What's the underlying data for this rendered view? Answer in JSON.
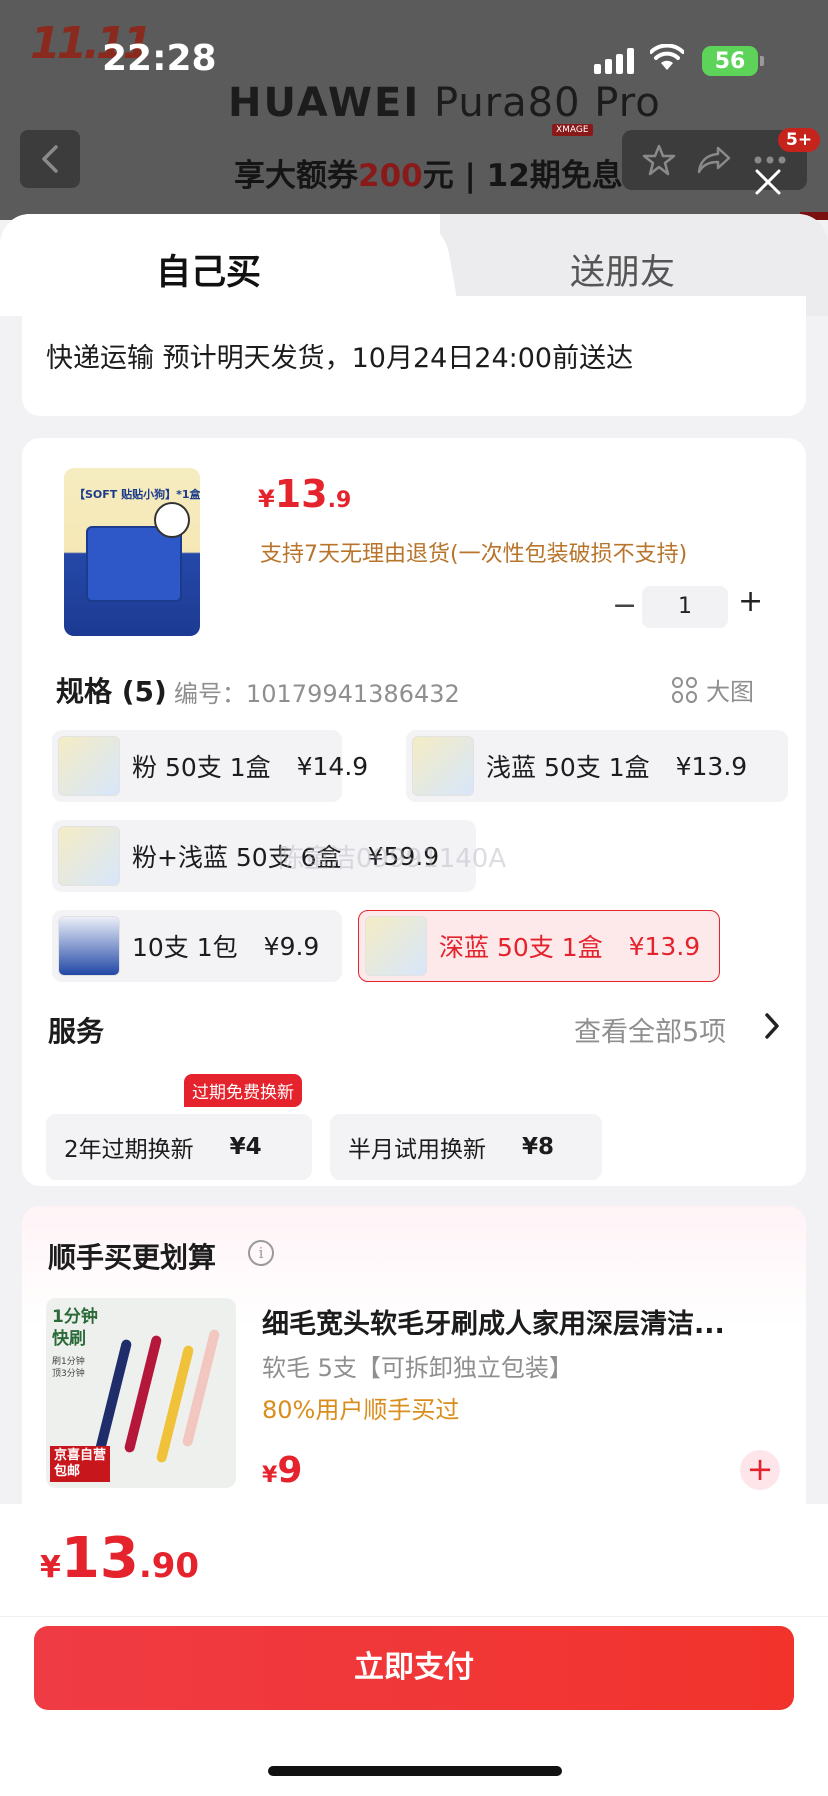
{
  "status_bar": {
    "time": "22:28",
    "battery": "56",
    "promo_logo": "11.11"
  },
  "banner": {
    "brand": "HUAWEI",
    "model": "Pura80 Pro",
    "xmage": "XMAGE",
    "promo_prefix": "享大额券",
    "promo_amount": "200",
    "promo_suffix": "元 | 12期免息",
    "cart_badge": "5+"
  },
  "tabs": [
    {
      "label": "自己买",
      "active": true
    },
    {
      "label": "送朋友",
      "active": false
    }
  ],
  "shipping": {
    "text": "快递运输  预计明天发货，10月24日24:00前送达"
  },
  "product": {
    "image_tag": "【SOFT 贴贴小狗】*1盒",
    "price_symbol": "¥",
    "price_int": "13",
    "price_dec": ".9",
    "return_note": "支持7天无理由退货(一次性包装破损不支持)",
    "quantity": "1",
    "minus": "−",
    "plus": "+"
  },
  "spec": {
    "title": "规格 (5)",
    "code": "编号：10179941386432",
    "big_image": "大图",
    "options": [
      {
        "label": "粉 50支 1盒",
        "price": "¥14.9",
        "selected": false
      },
      {
        "label": "浅蓝 50支 1盒",
        "price": "¥13.9",
        "selected": false
      },
      {
        "label": "粉+浅蓝 50支 6盒",
        "price": "¥59.9",
        "selected": false
      },
      {
        "label": "10支 1包",
        "price": "¥9.9",
        "selected": false
      },
      {
        "label": "深蓝 50支 1盒",
        "price": "¥13.9",
        "selected": true
      }
    ],
    "watermark": "陈童洁09991140A"
  },
  "service": {
    "title": "服务",
    "more": "查看全部5项",
    "badge": "过期免费换新",
    "items": [
      {
        "label": "2年过期换新",
        "price": "¥4"
      },
      {
        "label": "半月试用换新",
        "price": "¥8"
      }
    ]
  },
  "upsell": {
    "title": "顺手买更划算",
    "image_text_1": "1分钟",
    "image_text_2": "快刷",
    "image_text_3": "刷1分钟",
    "image_text_4": "顶3分钟",
    "image_tag_1": "京喜自营",
    "image_tag_2": "包邮",
    "name": "细毛宽头软毛牙刷成人家用深层清洁...",
    "desc": "软毛 5支【可拆卸独立包装】",
    "bought": "80%用户顺手买过",
    "price_symbol": "¥",
    "price": "9"
  },
  "bottom": {
    "total_symbol": "¥",
    "total_int": "13",
    "total_dec": ".90",
    "pay_label": "立即支付"
  }
}
